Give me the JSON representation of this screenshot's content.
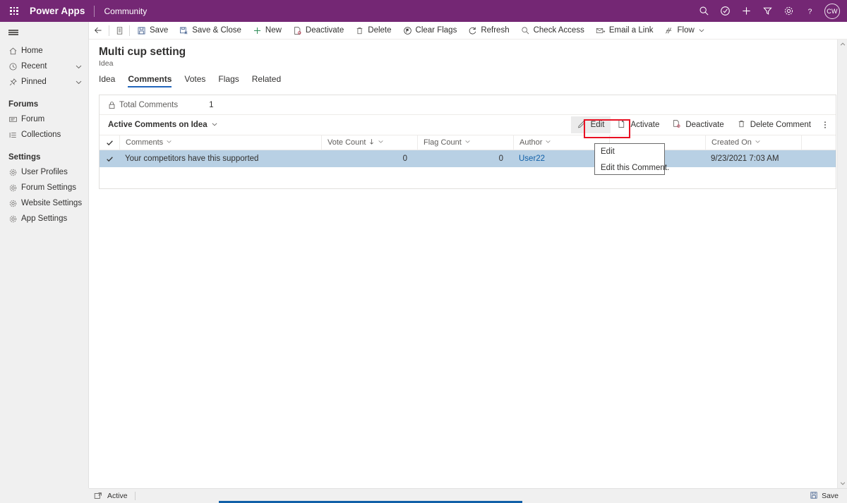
{
  "topbar": {
    "waffle_icon": "waffle-grid-icon",
    "brand": "Power Apps",
    "environment": "Community",
    "icons": [
      "search-icon",
      "tag-check-icon",
      "plus-icon",
      "filter-icon",
      "gear-icon",
      "help-icon"
    ],
    "avatar_initials": "CW",
    "background": "#742774"
  },
  "sidebar": {
    "menu_icon": "hamburger-icon",
    "items": [
      {
        "label": "Home",
        "icon": "home-icon",
        "chevron": false
      },
      {
        "label": "Recent",
        "icon": "clock-icon",
        "chevron": true
      },
      {
        "label": "Pinned",
        "icon": "pin-icon",
        "chevron": true
      }
    ],
    "groups": [
      {
        "title": "Forums",
        "items": [
          {
            "label": "Forum",
            "icon": "forum-icon"
          },
          {
            "label": "Collections",
            "icon": "list-icon"
          }
        ]
      },
      {
        "title": "Settings",
        "items": [
          {
            "label": "User Profiles",
            "icon": "gear-icon"
          },
          {
            "label": "Forum Settings",
            "icon": "gear-icon"
          },
          {
            "label": "Website Settings",
            "icon": "gear-icon"
          },
          {
            "label": "App Settings",
            "icon": "gear-icon"
          }
        ]
      }
    ]
  },
  "command_bar": {
    "back_icon": "arrow-left-icon",
    "form_icon": "form-icon",
    "buttons": [
      {
        "label": "Save",
        "icon": "save-icon"
      },
      {
        "label": "Save & Close",
        "icon": "save-close-icon"
      },
      {
        "label": "New",
        "icon": "plus-icon"
      },
      {
        "label": "Deactivate",
        "icon": "deactivate-icon"
      },
      {
        "label": "Delete",
        "icon": "trash-icon"
      },
      {
        "label": "Clear Flags",
        "icon": "clear-flags-icon"
      },
      {
        "label": "Refresh",
        "icon": "refresh-icon"
      },
      {
        "label": "Check Access",
        "icon": "check-access-icon"
      },
      {
        "label": "Email a Link",
        "icon": "email-link-icon"
      },
      {
        "label": "Flow",
        "icon": "flow-icon",
        "chevron": true
      }
    ]
  },
  "record": {
    "title": "Multi cup setting",
    "entity": "Idea"
  },
  "tabs": [
    {
      "label": "Idea",
      "active": false
    },
    {
      "label": "Comments",
      "active": true
    },
    {
      "label": "Votes",
      "active": false
    },
    {
      "label": "Flags",
      "active": false
    },
    {
      "label": "Related",
      "active": false
    }
  ],
  "subgrid": {
    "total_label": "Total Comments",
    "total_value": "1",
    "total_icon": "lock-icon",
    "view_name": "Active Comments on Idea",
    "view_chevron_icon": "chevron-down-icon",
    "toolbar": [
      {
        "label": "Edit",
        "icon": "pencil-icon",
        "highlighted": true
      },
      {
        "label": "Activate",
        "icon": "activate-icon",
        "highlighted": false
      },
      {
        "label": "Deactivate",
        "icon": "deactivate-icon",
        "highlighted": false
      },
      {
        "label": "Delete Comment",
        "icon": "trash-icon",
        "highlighted": false
      }
    ],
    "overflow_icon": "more-vertical-icon",
    "columns": [
      {
        "label": "Comments",
        "sorted": false
      },
      {
        "label": "Vote Count",
        "sorted": true,
        "sort_dir": "desc"
      },
      {
        "label": "Flag Count",
        "sorted": false
      },
      {
        "label": "Author",
        "sorted": false
      },
      {
        "label": "",
        "sorted": false
      },
      {
        "label": "Created On",
        "sorted": false
      }
    ],
    "rows": [
      {
        "selected": true,
        "comment": "Your competitors have this supported",
        "vote_count": "0",
        "flag_count": "0",
        "author": "User22",
        "blank": "",
        "created_on": "9/23/2021 7:03 AM"
      }
    ]
  },
  "tooltip": {
    "title": "Edit",
    "description": "Edit this Comment."
  },
  "annotation": {
    "target": "Edit",
    "color": "#e81123"
  },
  "footer": {
    "status_icon": "open-record-icon",
    "status": "Active",
    "save_label": "Save",
    "save_icon": "save-icon"
  },
  "scrollbar": {
    "up_icon": "chevron-up-icon",
    "down_icon": "chevron-down-icon"
  }
}
